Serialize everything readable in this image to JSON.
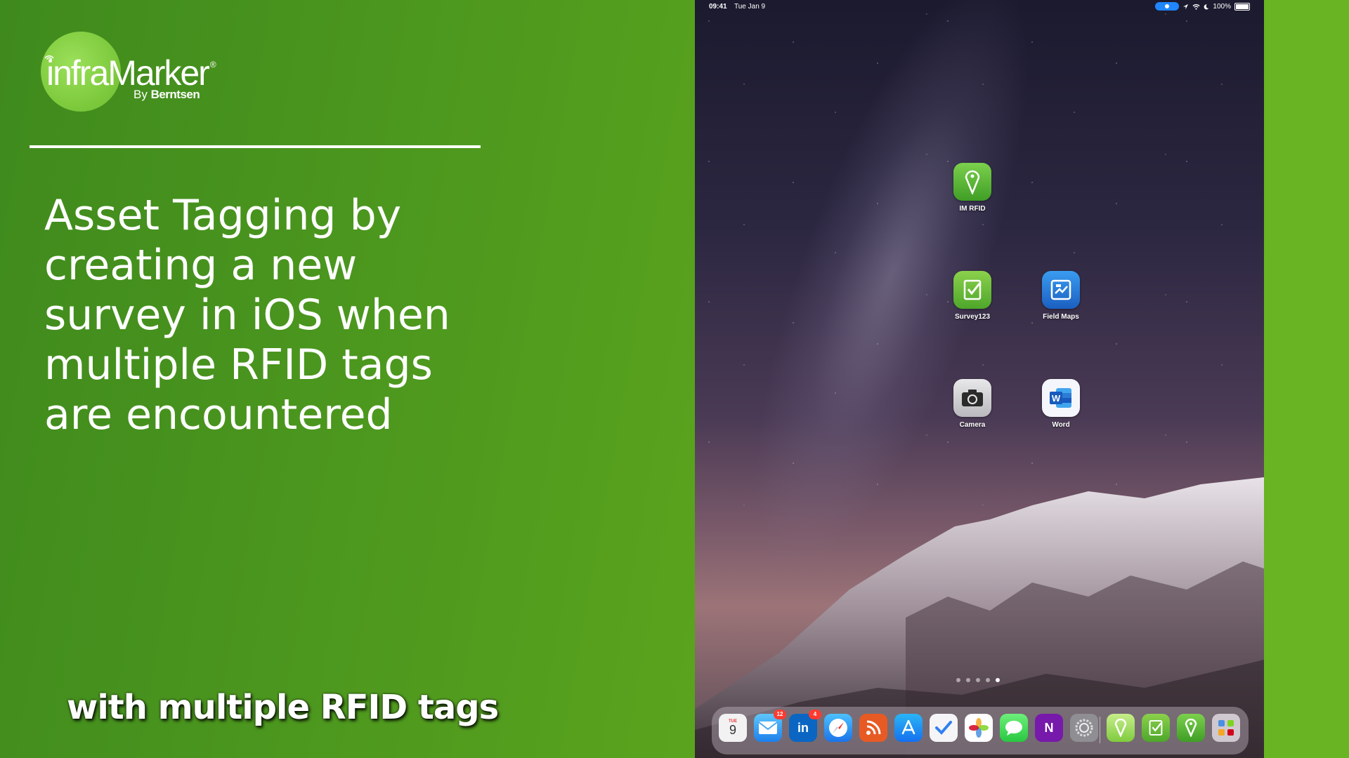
{
  "logo": {
    "wordmark": "infraMarker",
    "registered": "®",
    "by_prefix": "By",
    "by_brand": "Berntsen"
  },
  "headline": {
    "lines": [
      "Asset Tagging by",
      "creating a new",
      "survey in iOS when",
      "multiple RFID tags",
      "are encountered"
    ]
  },
  "caption": "with multiple RFID tags",
  "ipad": {
    "status": {
      "time": "09:41",
      "date": "Tue Jan 9",
      "battery": "100%"
    },
    "apps": [
      {
        "label": "IM RFID",
        "icon": "pin-icon",
        "color": "#5cb530"
      },
      {
        "label": "Survey123",
        "icon": "checklist-icon",
        "color": "#6cbb2c"
      },
      {
        "label": "Field Maps",
        "icon": "map-icon",
        "color": "#1f78d1"
      },
      {
        "label": "Camera",
        "icon": "camera-icon",
        "color": "#d9d9dc"
      },
      {
        "label": "Word",
        "icon": "word-icon",
        "color": "#f4f6fb"
      }
    ],
    "page_dots": {
      "count": 5,
      "active_index": 4
    },
    "dock": {
      "calendar": {
        "weekday": "TUE",
        "day": "9"
      },
      "mail_badge": "12",
      "linkedin_badge": "4",
      "linkedin_text": "in",
      "onenote_text": "N"
    }
  }
}
